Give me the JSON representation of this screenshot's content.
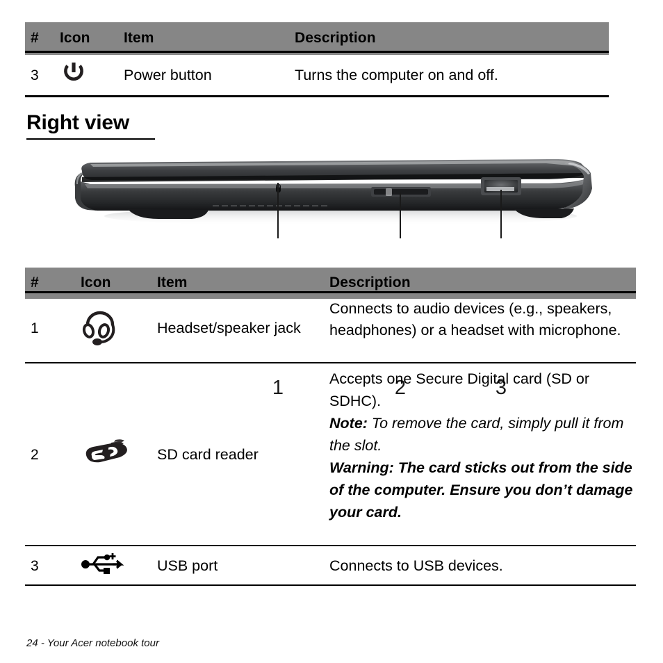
{
  "table_one": {
    "headers": [
      "#",
      "Icon",
      "Item",
      "Description"
    ],
    "rows": [
      {
        "num": "3",
        "icon": "power-button-icon",
        "item": "Power button",
        "description": "Turns the computer on and off."
      }
    ]
  },
  "heading": {
    "text": "Right view"
  },
  "figure": {
    "alt": "acer-notebook-right-side-view",
    "callouts": [
      "1",
      "2",
      "3"
    ]
  },
  "table_two": {
    "headers": [
      "#",
      "Icon",
      "Item",
      "Description"
    ],
    "rows": [
      {
        "num": "1",
        "icon": "headset-jack-icon",
        "item": "Headset/speaker jack",
        "description": "Connects to audio devices (e.g., speakers, headphones) or a headset with microphone."
      },
      {
        "num": "2",
        "icon": "sd-card-icon",
        "item": "SD card reader",
        "description_line_1": "Accepts one Secure Digital card (SD or SDHC).",
        "note_label": "Note:",
        "note_text": " To remove the card, simply pull it from the slot.",
        "warning_text": "Warning: The card sticks out from the side of the computer. Ensure you don’t damage your card."
      },
      {
        "num": "3",
        "icon": "usb-port-icon",
        "item": "USB port",
        "description": "Connects to USB devices."
      }
    ]
  },
  "footer": {
    "text": "24 - Your Acer notebook tour"
  },
  "colors": {
    "header_bar": "#868686",
    "rule": "#000000",
    "page_background": "#ffffff"
  }
}
